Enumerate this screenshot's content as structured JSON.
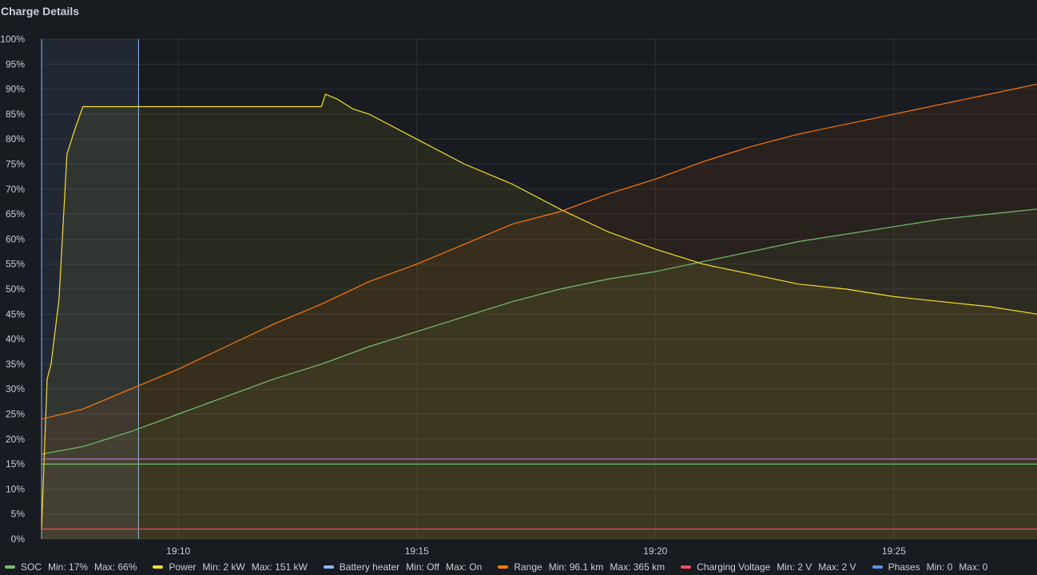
{
  "panel": {
    "title": "Charge Details"
  },
  "chart_data": {
    "type": "line",
    "y_unit_ticks": [
      "0%",
      "5%",
      "10%",
      "15%",
      "20%",
      "25%",
      "30%",
      "35%",
      "40%",
      "45%",
      "50%",
      "55%",
      "60%",
      "65%",
      "70%",
      "75%",
      "80%",
      "85%",
      "90%",
      "95%",
      "100%"
    ],
    "ylim": [
      0,
      100
    ],
    "xlim": [
      "19:07:08",
      "19:28:00"
    ],
    "x_ticks": [
      "19:10",
      "19:15",
      "19:20",
      "19:25"
    ],
    "grid": true,
    "legend_position": "bottom",
    "selection_region": {
      "start": "19:07:08",
      "end": "19:09:10"
    },
    "series": [
      {
        "name": "SOC",
        "color": "#73bf69",
        "stats": [
          "Min: 17%",
          "Max: 66%"
        ],
        "x": [
          "19:07:08",
          "19:08:00",
          "19:09:00",
          "19:10:00",
          "19:11:00",
          "19:12:00",
          "19:13:00",
          "19:14:00",
          "19:15:00",
          "19:16:00",
          "19:17:00",
          "19:18:00",
          "19:19:00",
          "19:20:00",
          "19:21:00",
          "19:22:00",
          "19:23:00",
          "19:24:00",
          "19:25:00",
          "19:26:00",
          "19:27:00",
          "19:28:00"
        ],
        "values": [
          17,
          18.5,
          21.5,
          25,
          28.5,
          32,
          35,
          38.5,
          41.5,
          44.5,
          47.5,
          50,
          52,
          53.5,
          55.5,
          57.5,
          59.5,
          61,
          62.5,
          64,
          65,
          66
        ]
      },
      {
        "name": "SOC reference",
        "color": "#73bf69",
        "x": [
          "19:07:08",
          "19:28:00"
        ],
        "values": [
          15,
          15
        ]
      },
      {
        "name": "Power",
        "color": "#fade2a",
        "stats": [
          "Min: 2 kW",
          "Max: 151 kW"
        ],
        "x": [
          "19:07:08",
          "19:07:15",
          "19:07:20",
          "19:07:30",
          "19:07:40",
          "19:07:50",
          "19:08:00",
          "19:10:00",
          "19:12:00",
          "19:13:00",
          "19:13:05",
          "19:13:20",
          "19:13:40",
          "19:14:00",
          "19:15:00",
          "19:16:00",
          "19:17:00",
          "19:18:00",
          "19:19:00",
          "19:20:00",
          "19:21:00",
          "19:22:00",
          "19:23:00",
          "19:24:00",
          "19:25:00",
          "19:26:00",
          "19:27:00",
          "19:28:00"
        ],
        "values": [
          2,
          32,
          35,
          48,
          77,
          82,
          86.5,
          86.5,
          86.5,
          86.5,
          89,
          88,
          86,
          85,
          80,
          75,
          71,
          66,
          61.5,
          58,
          55,
          53,
          51,
          50,
          48.5,
          47.5,
          46.5,
          45
        ]
      },
      {
        "name": "Battery heater",
        "color": "#8ab8ff",
        "stats": [
          "Min: Off",
          "Max: On"
        ],
        "x": [],
        "values": []
      },
      {
        "name": "Range",
        "color": "#ff780a",
        "stats": [
          "Min: 96.1 km",
          "Max: 365 km"
        ],
        "x": [
          "19:07:08",
          "19:08:00",
          "19:09:00",
          "19:10:00",
          "19:11:00",
          "19:12:00",
          "19:13:00",
          "19:14:00",
          "19:15:00",
          "19:16:00",
          "19:17:00",
          "19:18:00",
          "19:19:00",
          "19:20:00",
          "19:21:00",
          "19:22:00",
          "19:23:00",
          "19:24:00",
          "19:25:00",
          "19:26:00",
          "19:27:00",
          "19:28:00"
        ],
        "values": [
          24,
          26,
          30,
          34,
          38.5,
          43,
          47,
          51.5,
          55,
          59,
          63,
          65.5,
          69,
          72,
          75.5,
          78.5,
          81,
          83,
          85,
          87,
          89,
          91
        ]
      },
      {
        "name": "Charging Voltage",
        "color": "#f2495c",
        "stats": [
          "Min: 2 V",
          "Max: 2 V"
        ],
        "x": [
          "19:07:08",
          "19:28:00"
        ],
        "values": [
          2,
          2
        ]
      },
      {
        "name": "Phases",
        "color": "#5794f2",
        "stats": [
          "Min: 0",
          "Max: 0"
        ],
        "x": [],
        "values": []
      },
      {
        "name": "Phases reference",
        "color": "#b877d9",
        "x": [
          "19:07:08",
          "19:28:00"
        ],
        "values": [
          16,
          16
        ]
      }
    ]
  },
  "legend": [
    {
      "name": "SOC",
      "color": "#73bf69",
      "min": "Min: 17%",
      "max": "Max: 66%"
    },
    {
      "name": "Power",
      "color": "#fade2a",
      "min": "Min: 2 kW",
      "max": "Max: 151 kW"
    },
    {
      "name": "Battery heater",
      "color": "#8ab8ff",
      "min": "Min: Off",
      "max": "Max: On"
    },
    {
      "name": "Range",
      "color": "#ff780a",
      "min": "Min: 96.1 km",
      "max": "Max: 365 km"
    },
    {
      "name": "Charging Voltage",
      "color": "#f2495c",
      "min": "Min: 2 V",
      "max": "Max: 2 V"
    },
    {
      "name": "Phases",
      "color": "#5794f2",
      "min": "Min: 0",
      "max": "Max: 0"
    }
  ]
}
